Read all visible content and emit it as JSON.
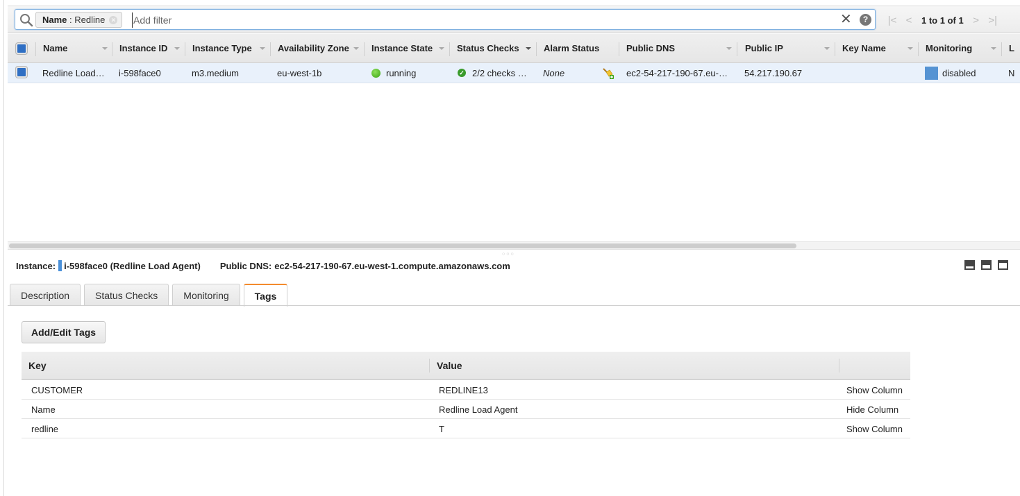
{
  "filter": {
    "chip_key": "Name",
    "chip_sep": ":",
    "chip_value": "Redline",
    "placeholder": "Add filter",
    "value": ""
  },
  "pager": {
    "text": "1 to 1 of 1",
    "first": "|<",
    "prev": "<",
    "next": ">",
    "last": ">|"
  },
  "grid": {
    "columns": [
      "Name",
      "Instance ID",
      "Instance Type",
      "Availability Zone",
      "Instance State",
      "Status Checks",
      "Alarm Status",
      "Public DNS",
      "Public IP",
      "Key Name",
      "Monitoring",
      "L"
    ],
    "rows": [
      {
        "name": "Redline Load…",
        "instance_id": "i-598face0",
        "instance_type": "m3.medium",
        "availability_zone": "eu-west-1b",
        "instance_state": "running",
        "status_checks": "2/2 checks …",
        "alarm_status": "None",
        "public_dns": "ec2-54-217-190-67.eu-…",
        "public_ip": "54.217.190.67",
        "key_name": "",
        "monitoring": "disabled",
        "last": "N"
      }
    ]
  },
  "detail": {
    "instance_label": "Instance:",
    "instance_value": "i-598face0 (Redline Load Agent)",
    "dns_label": "Public DNS:",
    "dns_value": "ec2-54-217-190-67.eu-west-1.compute.amazonaws.com",
    "tabs": [
      {
        "label": "Description",
        "active": false
      },
      {
        "label": "Status Checks",
        "active": false
      },
      {
        "label": "Monitoring",
        "active": false
      },
      {
        "label": "Tags",
        "active": true
      }
    ]
  },
  "tags": {
    "add_button": "Add/Edit Tags",
    "headers": {
      "key": "Key",
      "value": "Value"
    },
    "rows": [
      {
        "key": "CUSTOMER",
        "value": "REDLINE13",
        "action": "Show Column"
      },
      {
        "key": "Name",
        "value": "Redline Load Agent",
        "action": "Hide Column"
      },
      {
        "key": "redline",
        "value": "T",
        "action": "Show Column"
      }
    ]
  },
  "colors": {
    "accent_blue": "#2f6fc4",
    "active_tab": "#f38b2d",
    "running_green": "#3aa313",
    "selected_row": "#e9f1fb"
  }
}
